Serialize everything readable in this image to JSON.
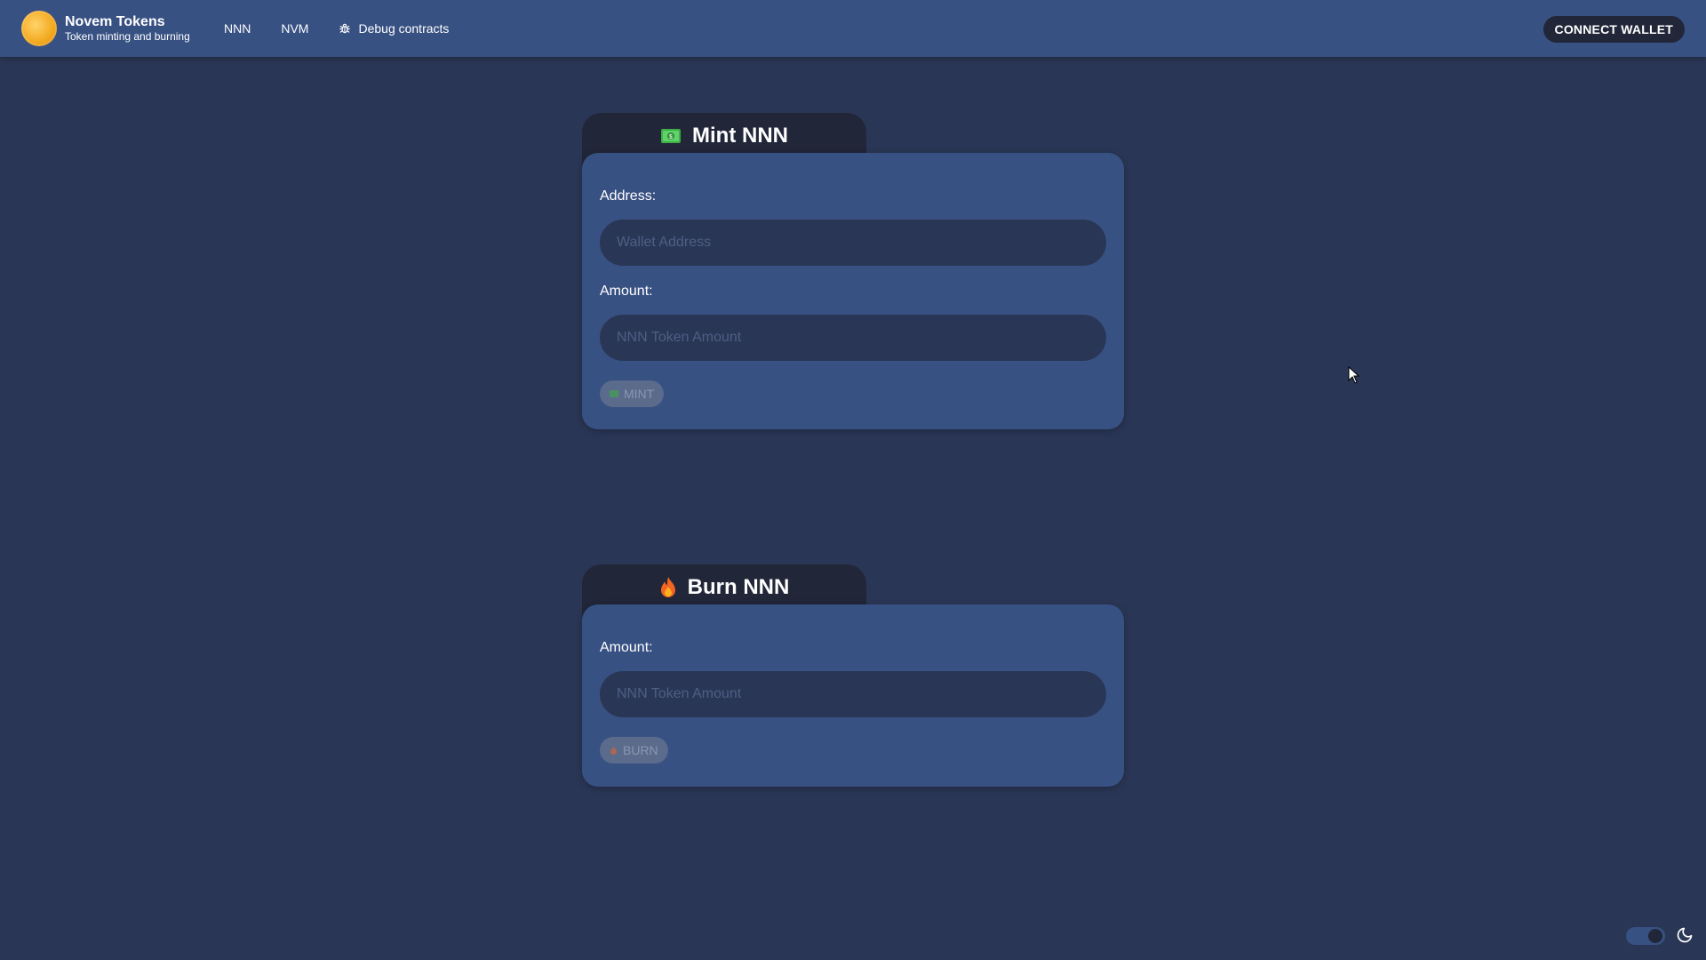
{
  "header": {
    "brand_title": "Novem Tokens",
    "brand_subtitle": "Token minting and burning",
    "nav": [
      {
        "label": "NNN"
      },
      {
        "label": "NVM"
      },
      {
        "label": "Debug contracts",
        "icon": "bug-icon"
      }
    ],
    "connect_label": "CONNECT WALLET"
  },
  "mint": {
    "title": "Mint NNN",
    "title_icon": "money-icon",
    "address_label": "Address:",
    "address_placeholder": "Wallet Address",
    "address_value": "",
    "amount_label": "Amount:",
    "amount_placeholder": "NNN Token Amount",
    "amount_value": "",
    "button_label": "MINT",
    "button_icon": "money-icon",
    "button_disabled": true
  },
  "burn": {
    "title": "Burn NNN",
    "title_icon": "fire-icon",
    "amount_label": "Amount:",
    "amount_placeholder": "NNN Token Amount",
    "amount_value": "",
    "button_label": "BURN",
    "button_icon": "fire-icon",
    "button_disabled": true
  },
  "theme": {
    "mode": "dark",
    "icon": "moon-icon"
  },
  "colors": {
    "background": "#2a3655",
    "header": "#385183",
    "card": "#385183",
    "card_tab": "#212638",
    "button_dark": "#212638"
  }
}
